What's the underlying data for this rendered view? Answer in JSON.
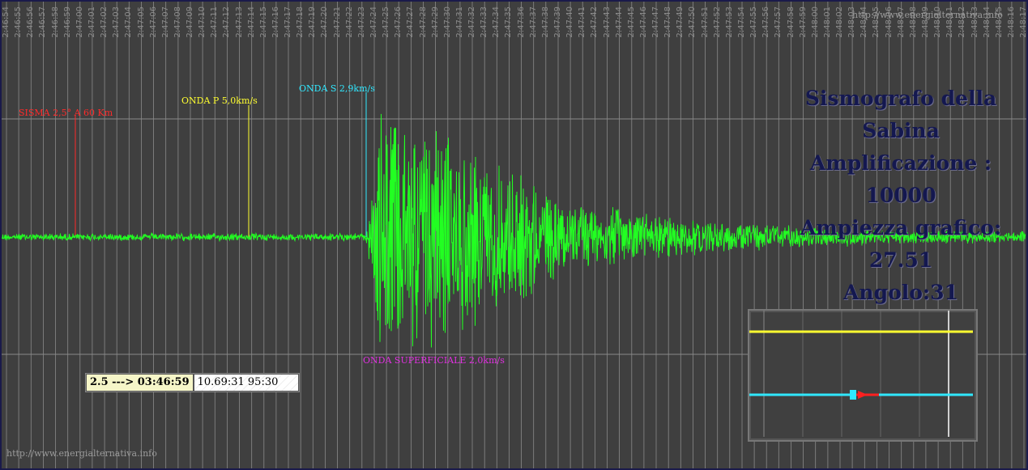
{
  "watermark_top": "http://www.energialternativa.info",
  "watermark_bottom": "http://www.energialternativa.info",
  "title": {
    "line1": "Sismografo della Sabina",
    "line2": "Amplificazione : 10000",
    "line3": "Ampiezza grafico: 27.51",
    "line4": "Angolo:31"
  },
  "markers": [
    {
      "label": "SISMA 2,5° A 60 Km",
      "color": "#ff2a2a"
    },
    {
      "label": "ONDA P 5,0km/s",
      "color": "#ffff30"
    },
    {
      "label": "ONDA S 2,9km/s",
      "color": "#30e8ff"
    },
    {
      "label": "ONDA SUPERFICIALE 2,0km/s",
      "color": "#e030e0"
    }
  ],
  "readout": {
    "magnitude_time": "2.5 ---> 03:46:59",
    "coords": "10.69:31 95:30"
  },
  "time_ticks": [
    "2:46:54",
    "2:46:55",
    "2:46:56",
    "2:46:57",
    "2:46:58",
    "2:46:59",
    "2:47:00",
    "2:47:01",
    "2:47:02",
    "2:47:03",
    "2:47:04",
    "2:47:05",
    "2:47:06",
    "2:47:07",
    "2:47:08",
    "2:47:09",
    "2:47:10",
    "2:47:11",
    "2:47:12",
    "2:47:13",
    "2:47:14",
    "2:47:15",
    "2:47:16",
    "2:47:17",
    "2:47:18",
    "2:47:19",
    "2:47:20",
    "2:47:21",
    "2:47:22",
    "2:47:23",
    "2:47:24",
    "2:47:25",
    "2:47:26",
    "2:47:27",
    "2:47:28",
    "2:47:29",
    "2:47:30",
    "2:47:31",
    "2:47:32",
    "2:47:33",
    "2:47:34",
    "2:47:35",
    "2:47:36",
    "2:47:37",
    "2:47:38",
    "2:47:39",
    "2:47:40",
    "2:47:41",
    "2:47:42",
    "2:47:43",
    "2:47:44",
    "2:47:45",
    "2:47:46",
    "2:47:47",
    "2:47:48",
    "2:47:49",
    "2:47:50",
    "2:47:51",
    "2:47:52",
    "2:47:53",
    "2:47:54",
    "2:47:55",
    "2:47:56",
    "2:47:57",
    "2:47:58",
    "2:47:59",
    "2:48:00",
    "2:48:01",
    "2:48:02",
    "2:48:03",
    "2:48:04",
    "2:48:05",
    "2:48:06",
    "2:48:07",
    "2:48:08",
    "2:48:09",
    "2:48:10",
    "2:48:11",
    "2:48:12",
    "2:48:13",
    "2:48:14",
    "2:48:15",
    "2:48:16",
    "2:48:17"
  ],
  "colors": {
    "background": "#3f3f3f",
    "trace": "#22ff22",
    "grid": "#8a8a8a",
    "title": "#141850",
    "mini_primary": "#ffff30",
    "mini_secondary": "#30e8ff"
  }
}
